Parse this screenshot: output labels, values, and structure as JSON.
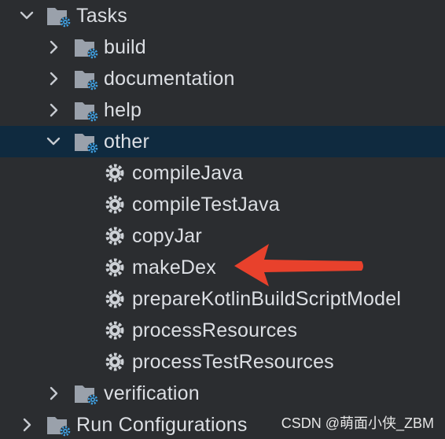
{
  "tree": {
    "tasks": {
      "label": "Tasks",
      "expanded": true
    },
    "groups": [
      {
        "label": "build",
        "expanded": false
      },
      {
        "label": "documentation",
        "expanded": false
      },
      {
        "label": "help",
        "expanded": false
      },
      {
        "label": "other",
        "expanded": true,
        "selected": true
      },
      {
        "label": "verification",
        "expanded": false
      }
    ],
    "other_tasks": [
      "compileJava",
      "compileTestJava",
      "copyJar",
      "makeDex",
      "prepareKotlinBuildScriptModel",
      "processResources",
      "processTestResources"
    ],
    "run_configurations": {
      "label": "Run Configurations",
      "expanded": false
    }
  },
  "annotation": {
    "color": "#e8412c",
    "points_to": "makeDex"
  },
  "watermark": "CSDN @萌面小侠_ZBM",
  "colors": {
    "background": "#2b2d30",
    "selected_row": "#0f2a3f",
    "folder": "#9aa1ab",
    "gear_badge": "#3f9fe0",
    "gear": "#cdd1d6",
    "text": "#dcdfe4"
  }
}
